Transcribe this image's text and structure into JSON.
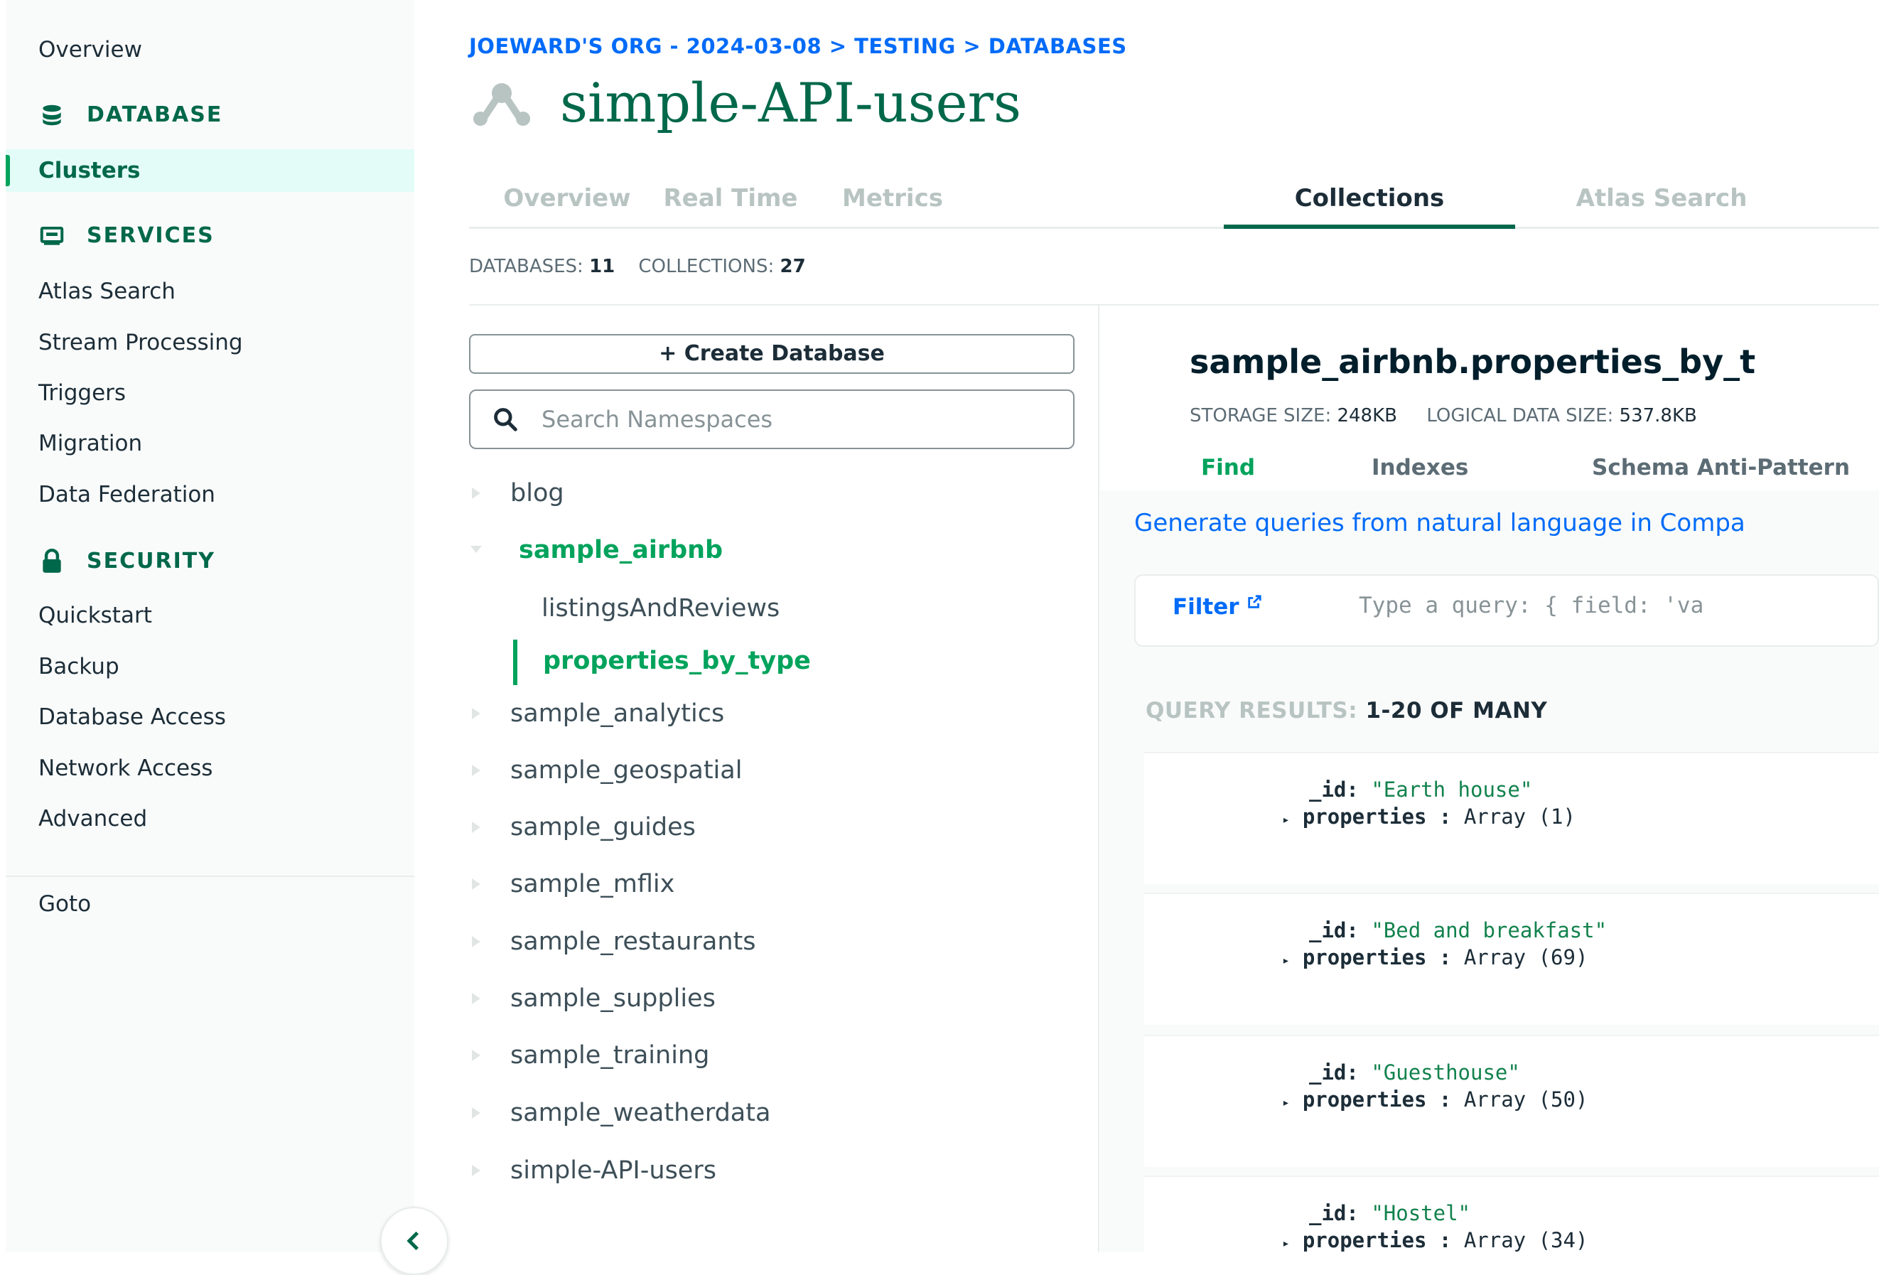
{
  "sidebar": {
    "overview": "Overview",
    "sections": {
      "database": "DATABASE",
      "services": "SERVICES",
      "security": "SECURITY"
    },
    "database_items": [
      "Clusters"
    ],
    "services_items": [
      "Atlas Search",
      "Stream Processing",
      "Triggers",
      "Migration",
      "Data Federation"
    ],
    "security_items": [
      "Quickstart",
      "Backup",
      "Database Access",
      "Network Access",
      "Advanced"
    ],
    "goto": "Goto"
  },
  "header": {
    "breadcrumb": "JOEWARD'S ORG - 2024-03-08 > TESTING > DATABASES",
    "title": "simple-API-users",
    "tabs": [
      "Overview",
      "Real Time",
      "Metrics",
      "Collections",
      "Atlas Search"
    ],
    "active_tab": "Collections"
  },
  "counts": {
    "databases_label": "DATABASES:",
    "databases_value": "11",
    "collections_label": "COLLECTIONS:",
    "collections_value": "27"
  },
  "namespace": {
    "create_label": "+ Create Database",
    "search_placeholder": "Search Namespaces",
    "databases": [
      "blog",
      "sample_airbnb",
      "sample_analytics",
      "sample_geospatial",
      "sample_guides",
      "sample_mflix",
      "sample_restaurants",
      "sample_supplies",
      "sample_training",
      "sample_weatherdata",
      "simple-API-users"
    ],
    "open_database": "sample_airbnb",
    "collections": [
      "listingsAndReviews",
      "properties_by_type"
    ],
    "active_collection": "properties_by_type"
  },
  "collection": {
    "title": "sample_airbnb.properties_by_t",
    "storage_label": "STORAGE SIZE:",
    "storage_value": "248KB",
    "logical_label": "LOGICAL DATA SIZE:",
    "logical_value": "537.8KB",
    "tabs": [
      "Find",
      "Indexes",
      "Schema Anti-Pattern"
    ],
    "active_tab": "Find",
    "nl_link": "Generate queries from natural language in Compa",
    "filter_label": "Filter",
    "filter_placeholder": "Type a query: { field: 'va",
    "results_label": "QUERY RESULTS:",
    "results_value": "1-20 OF MANY",
    "documents": [
      {
        "id": "\"Earth house\"",
        "properties": "Array (1)"
      },
      {
        "id": "\"Bed and breakfast\"",
        "properties": "Array (69)"
      },
      {
        "id": "\"Guesthouse\"",
        "properties": "Array (50)"
      },
      {
        "id": "\"Hostel\"",
        "properties": "Array (34)"
      }
    ],
    "id_key": "_id:",
    "properties_key": "properties :"
  },
  "colors": {
    "green_dark": "#00684a",
    "green": "#00a35c",
    "link_blue": "#016bf8",
    "active_bg": "#e3fcf7"
  }
}
